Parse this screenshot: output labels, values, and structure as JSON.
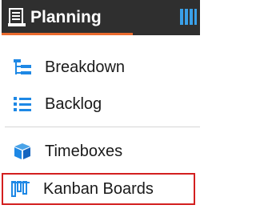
{
  "header": {
    "active_tab": {
      "label": "Planning",
      "icon": "document-list-icon",
      "accent_color": "#ea6a2e",
      "background": "#2f2f2f"
    },
    "next_tab": {
      "icon": "columns-icon"
    }
  },
  "menu": {
    "items": [
      {
        "label": "Breakdown",
        "icon": "hierarchy-tree-icon",
        "color": "#1e88e5"
      },
      {
        "label": "Backlog",
        "icon": "bullet-list-icon",
        "color": "#1e88e5"
      },
      {
        "label": "Timeboxes",
        "icon": "cube-stack-icon",
        "color": "#1e88e5"
      },
      {
        "label": "Kanban Boards",
        "icon": "kanban-board-icon",
        "color": "#1e88e5",
        "highlighted": true,
        "highlight_color": "#d31f1f"
      }
    ]
  }
}
